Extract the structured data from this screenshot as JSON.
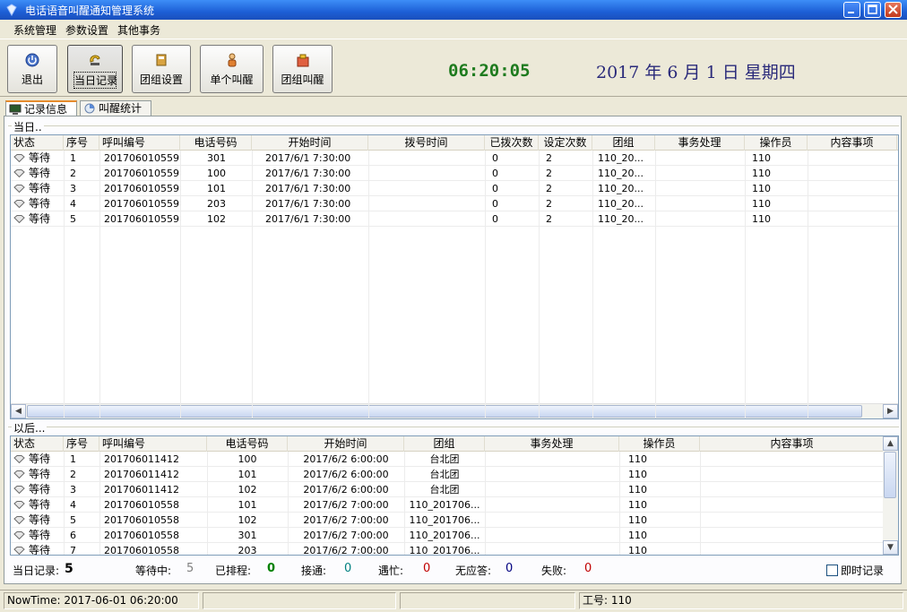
{
  "window": {
    "title": "电话语音叫醒通知管理系统",
    "buttons": [
      "_",
      "□",
      "✕"
    ]
  },
  "menu": [
    "系统管理",
    "参数设置",
    "其他事务"
  ],
  "toolbar": [
    {
      "label": "退出",
      "icon": "power-icon"
    },
    {
      "label": "当日记录",
      "icon": "phone-icon"
    },
    {
      "label": "团组设置",
      "icon": "book-icon"
    },
    {
      "label": "单个叫醒",
      "icon": "person-icon"
    },
    {
      "label": "团组叫醒",
      "icon": "group-icon"
    }
  ],
  "clock": "06:20:05",
  "date": "2017 年 6 月 1 日 星期四",
  "tabs": [
    "记录信息",
    "叫醒统计"
  ],
  "today": {
    "label": "当日..",
    "headers": [
      "状态",
      "序号",
      "呼叫编号",
      "电话号码",
      "开始时间",
      "拨号时间",
      "已拨次数",
      "设定次数",
      "团组",
      "事务处理",
      "操作员",
      "内容事项"
    ],
    "rows": [
      [
        "等待",
        "1",
        "201706010559",
        "301",
        "2017/6/1 7:30:00",
        "",
        "0",
        "2",
        "110_20...",
        "",
        "110",
        ""
      ],
      [
        "等待",
        "2",
        "201706010559",
        "100",
        "2017/6/1 7:30:00",
        "",
        "0",
        "2",
        "110_20...",
        "",
        "110",
        ""
      ],
      [
        "等待",
        "3",
        "201706010559",
        "101",
        "2017/6/1 7:30:00",
        "",
        "0",
        "2",
        "110_20...",
        "",
        "110",
        ""
      ],
      [
        "等待",
        "4",
        "201706010559",
        "203",
        "2017/6/1 7:30:00",
        "",
        "0",
        "2",
        "110_20...",
        "",
        "110",
        ""
      ],
      [
        "等待",
        "5",
        "201706010559",
        "102",
        "2017/6/1 7:30:00",
        "",
        "0",
        "2",
        "110_20...",
        "",
        "110",
        ""
      ]
    ]
  },
  "later": {
    "label": "以后...",
    "headers": [
      "状态",
      "序号",
      "呼叫编号",
      "电话号码",
      "开始时间",
      "团组",
      "事务处理",
      "操作员",
      "内容事项"
    ],
    "rows": [
      [
        "等待",
        "1",
        "201706011412",
        "100",
        "2017/6/2 6:00:00",
        "台北团",
        "",
        "110",
        ""
      ],
      [
        "等待",
        "2",
        "201706011412",
        "101",
        "2017/6/2 6:00:00",
        "台北团",
        "",
        "110",
        ""
      ],
      [
        "等待",
        "3",
        "201706011412",
        "102",
        "2017/6/2 6:00:00",
        "台北团",
        "",
        "110",
        ""
      ],
      [
        "等待",
        "4",
        "201706010558",
        "101",
        "2017/6/2 7:00:00",
        "110_201706...",
        "",
        "110",
        ""
      ],
      [
        "等待",
        "5",
        "201706010558",
        "102",
        "2017/6/2 7:00:00",
        "110_201706...",
        "",
        "110",
        ""
      ],
      [
        "等待",
        "6",
        "201706010558",
        "301",
        "2017/6/2 7:00:00",
        "110_201706...",
        "",
        "110",
        ""
      ],
      [
        "等待",
        "7",
        "201706010558",
        "203",
        "2017/6/2 7:00:00",
        "110_201706...",
        "",
        "110",
        ""
      ]
    ]
  },
  "stats": {
    "today_label": "当日记录:",
    "today_value": "5",
    "waiting_label": "等待中:",
    "waiting_value": "5",
    "scheduled_label": "已排程:",
    "scheduled_value": "0",
    "connected_label": "接通:",
    "connected_value": "0",
    "busy_label": "遇忙:",
    "busy_value": "0",
    "noanswer_label": "无应答:",
    "noanswer_value": "0",
    "failed_label": "失败:",
    "failed_value": "0",
    "instant_label": "即时记录"
  },
  "colors": {
    "waiting": "#808080",
    "scheduled": "#008000",
    "connected": "#008080",
    "busy": "#c00000",
    "noanswer": "#000080",
    "failed": "#c00000",
    "clock": "#1e7b1e",
    "date": "#2a2a7a"
  },
  "statusbar": {
    "nowtime": "NowTime: 2017-06-01 06:20:00",
    "operator": "工号: 110"
  }
}
